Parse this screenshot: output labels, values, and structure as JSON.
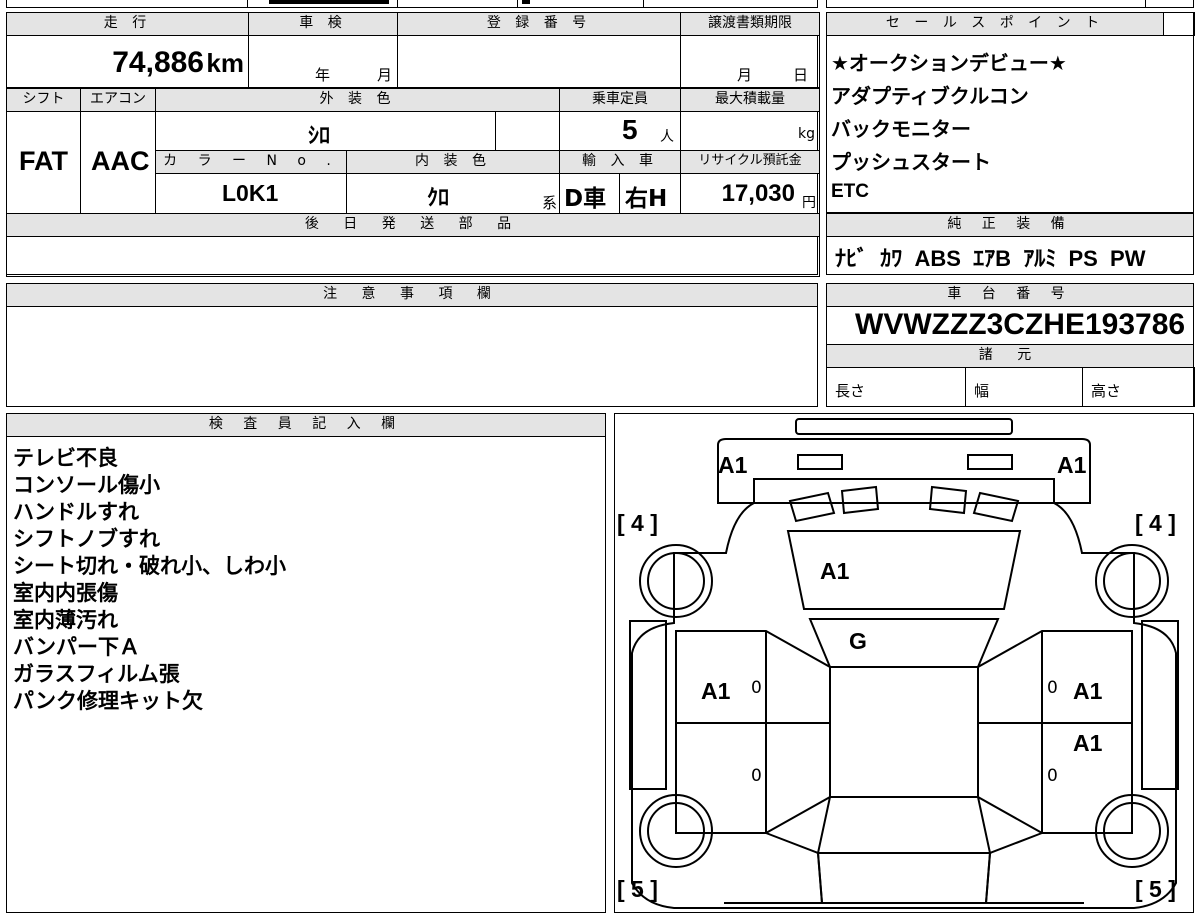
{
  "labels": {
    "mileage": "走 行",
    "shaken": "車 検",
    "registration": "登 録 番 号",
    "transfer_deadline": "譲渡書類期限",
    "sales_points": "セ ー ル ス ポ イ ン ト",
    "shift": "シフト",
    "aircon": "エアコン",
    "exterior_color": "外 装 色",
    "capacity": "乗車定員",
    "max_load": "最大積載量",
    "color_no": "カ ラ ー N o .",
    "interior_color": "内 装 色",
    "import": "輸 入 車",
    "recycle_fee": "リサイクル預託金",
    "later_parts": "後 日 発 送 部 品",
    "genuine_equipment": "純 正 装 備",
    "notes": "注 意 事 項 欄",
    "chassis_no": "車 台 番 号",
    "specs": "諸 元",
    "length": "長さ",
    "width": "幅",
    "height": "高さ",
    "inspector": "検 査 員 記 入 欄",
    "year_unit": "年",
    "month_unit": "月",
    "day_unit": "日",
    "km_unit": "km",
    "person_unit": "人",
    "kg_unit": "kg",
    "yen_unit": "円",
    "kei_unit": "系"
  },
  "values": {
    "mileage": "74,886",
    "shift": "FAT",
    "aircon": "AAC",
    "exterior_color": "ｼﾛ",
    "capacity": "5",
    "color_no": "L0K1",
    "interior_color": "ｸﾛ",
    "import_car": "D車",
    "handle": "右H",
    "recycle_fee": "17,030",
    "chassis_no": "WVWZZZ3CZHE193786",
    "genuine_equipment": "ﾅﾋﾞ  ｶﾜ  ABS  ｴｱB  ｱﾙﾐ  PS  PW"
  },
  "sales_points": [
    "★オークションデビュー★",
    "アダプティブクルコン",
    "バックモニター",
    "プッシュスタート",
    "ETC"
  ],
  "inspector_notes": [
    "テレビ不良",
    "コンソール傷小",
    "ハンドルすれ",
    "シフトノブすれ",
    "シート切れ・破れ小、しわ小",
    "室内内張傷",
    "室内薄汚れ",
    "バンパー下Ａ",
    "ガラスフィルム張",
    "パンク修理キット欠"
  ],
  "diagram": {
    "marks": [
      "A1",
      "A1",
      "A1",
      "G",
      "A1",
      "A1",
      "A1"
    ],
    "tire_front_left": "[ 4 ]",
    "tire_front_right": "[ 4 ]",
    "tire_rear_left": "[ 5 ]",
    "tire_rear_right": "[ 5 ]",
    "zero": "0"
  }
}
